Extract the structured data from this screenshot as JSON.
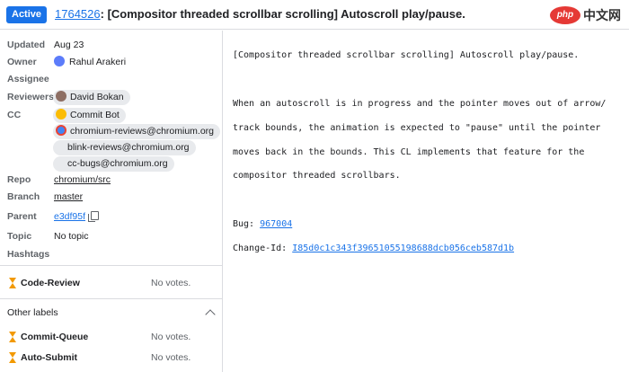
{
  "header": {
    "status": "Active",
    "change_number": "1764526",
    "title_rest": ": [Compositor threaded scrollbar scrolling] Autoscroll play/pause."
  },
  "watermark": {
    "oval": "php",
    "text": "中文网"
  },
  "metadata": {
    "updated": {
      "label": "Updated",
      "value": "Aug 23"
    },
    "owner": {
      "label": "Owner",
      "value": "Rahul Arakeri"
    },
    "assignee": {
      "label": "Assignee",
      "value": ""
    },
    "reviewers": {
      "label": "Reviewers",
      "items": [
        "David Bokan"
      ]
    },
    "cc": {
      "label": "CC",
      "items": [
        "Commit Bot",
        "chromium-reviews@chromium.org",
        "blink-reviews@chromium.org",
        "cc-bugs@chromium.org"
      ]
    },
    "repo": {
      "label": "Repo",
      "value": "chromium/src"
    },
    "branch": {
      "label": "Branch",
      "value": "master"
    },
    "parent": {
      "label": "Parent",
      "value": "e3df95f"
    },
    "topic": {
      "label": "Topic",
      "value": "No topic"
    },
    "hashtags": {
      "label": "Hashtags",
      "value": ""
    }
  },
  "labels": {
    "code_review": {
      "name": "Code-Review",
      "value": "No votes."
    },
    "other_title": "Other labels",
    "commit_queue": {
      "name": "Commit-Queue",
      "value": "No votes."
    },
    "auto_submit": {
      "name": "Auto-Submit",
      "value": "No votes."
    }
  },
  "commit_message": {
    "subject": "[Compositor threaded scrollbar scrolling] Autoscroll play/pause.",
    "body": [
      "When an autoscroll is in progress and the pointer moves out of arrow/",
      "track bounds, the animation is expected to \"pause\" until the pointer",
      "moves back in the bounds. This CL implements that feature for the",
      "compositor threaded scrollbars."
    ],
    "bug_label": "Bug: ",
    "bug_value": "967004",
    "change_id_label": "Change-Id: ",
    "change_id_value": "I85d0c1c343f39651055198688dcb056ceb587d1b"
  },
  "colors": {
    "accent": "#1a73e8",
    "status_badge": "#1a73e8",
    "pending": "#f29900"
  }
}
